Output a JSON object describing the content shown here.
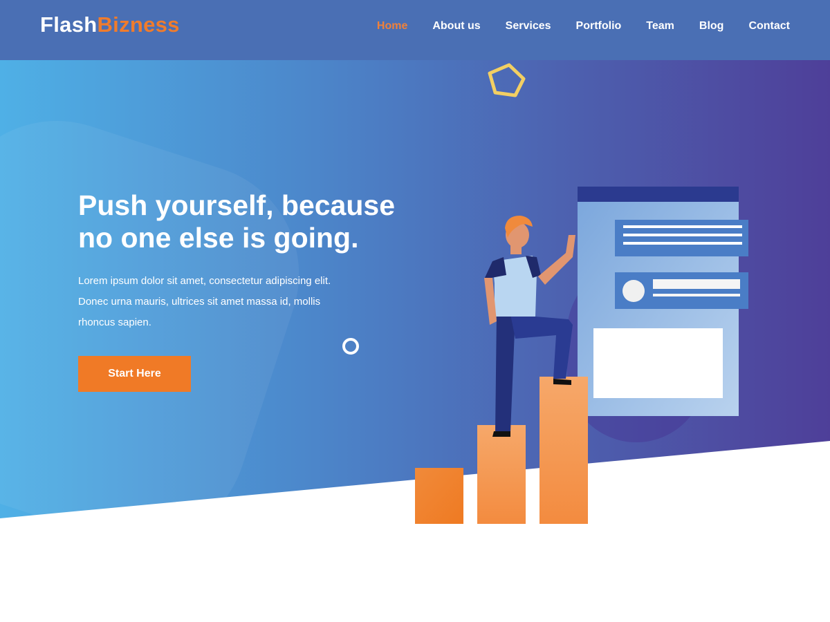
{
  "brand": {
    "logo_main": "Flash",
    "logo_accent": "Bizness"
  },
  "nav": {
    "items": [
      {
        "label": "Home",
        "active": true
      },
      {
        "label": "About us",
        "active": false
      },
      {
        "label": "Services",
        "active": false
      },
      {
        "label": "Portfolio",
        "active": false
      },
      {
        "label": "Team",
        "active": false
      },
      {
        "label": "Blog",
        "active": false
      },
      {
        "label": "Contact",
        "active": false
      }
    ]
  },
  "hero": {
    "headline_line1": "Push yourself, because",
    "headline_line2": "no one else is going.",
    "paragraph": "Lorem ipsum dolor sit amet, consectetur adipiscing elit. Donec urna mauris, ultrices sit amet massa id, mollis rhoncus sapien.",
    "cta_label": "Start Here"
  },
  "colors": {
    "header_bg": "#4a6fb4",
    "accent_orange": "#f07a26",
    "active_nav": "#f0813a",
    "pentagon_yellow": "#f3cf63"
  },
  "icons": [
    "pentagon-shape-icon",
    "ring-shape-icon"
  ]
}
